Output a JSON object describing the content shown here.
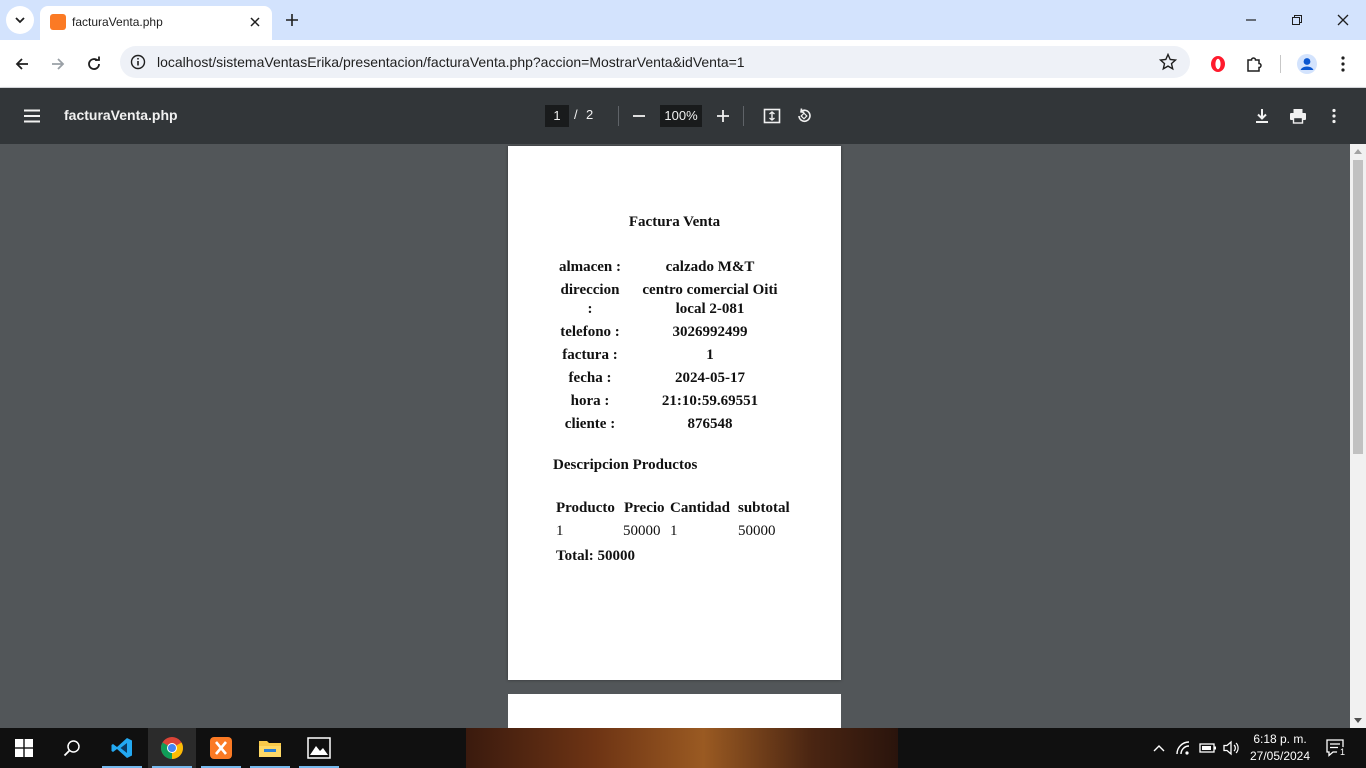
{
  "browser": {
    "tab": {
      "title": "facturaVenta.php"
    },
    "url": "localhost/sistemaVentasErika/presentacion/facturaVenta.php?accion=MostrarVenta&idVenta=1"
  },
  "pdf": {
    "title": "facturaVenta.php",
    "current_page": "1",
    "page_sep": "/",
    "total_pages": "2",
    "zoom": "100%"
  },
  "invoice": {
    "title": "Factura Venta",
    "fields": [
      {
        "label": "almacen :",
        "value": "calzado M&T"
      },
      {
        "label_line1": "direccion",
        "label_line2": ":",
        "value_line1": "centro comercial Oiti",
        "value_line2": "local 2-081"
      },
      {
        "label": "telefono :",
        "value": "3026992499"
      },
      {
        "label": "factura :",
        "value": "1"
      },
      {
        "label": "fecha :",
        "value": "2024-05-17"
      },
      {
        "label": "hora :",
        "value": "21:10:59.69551"
      },
      {
        "label": "cliente :",
        "value": "876548"
      }
    ],
    "section_title": "Descripcion Productos",
    "table": {
      "headers": [
        "Producto",
        "Precio",
        "Cantidad",
        "subtotal"
      ],
      "rows": [
        [
          "1",
          "50000",
          "1",
          "50000"
        ]
      ]
    },
    "total": "Total: 50000"
  },
  "taskbar": {
    "clock_time": "6:18 p. m.",
    "clock_date": "27/05/2024",
    "notification_count": "1"
  },
  "colors": {
    "tabstrip": "#d3e3fd",
    "pdf_toolbar": "#323639",
    "viewer_bg": "#525659",
    "xampp": "#fb7a24"
  }
}
